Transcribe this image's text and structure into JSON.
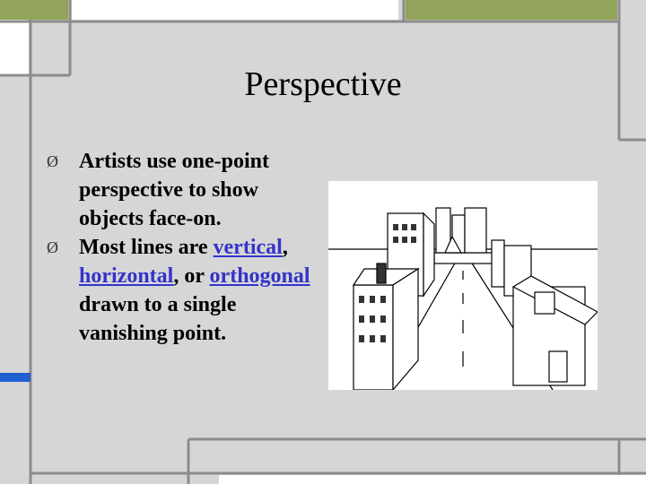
{
  "slide": {
    "title": "Perspective",
    "bullets": [
      {
        "marker": "Ø",
        "text": "Artists use one-point perspective to show objects face-on."
      },
      {
        "marker": "Ø",
        "prefix": "Most lines are ",
        "link1": "vertical",
        "sep1": ", ",
        "link2": "horizontal",
        "sep2": ", or ",
        "link3": "orthogonal ",
        "suffix": "drawn to a single vanishing point."
      }
    ],
    "illustration": {
      "icon": "one-point-perspective-street-drawing-icon"
    }
  },
  "colors": {
    "background": "#d6d6d6",
    "frame": "#8c8c8c",
    "green": "#92a35a",
    "blue": "#1f5fd0",
    "link": "#3333cc"
  }
}
